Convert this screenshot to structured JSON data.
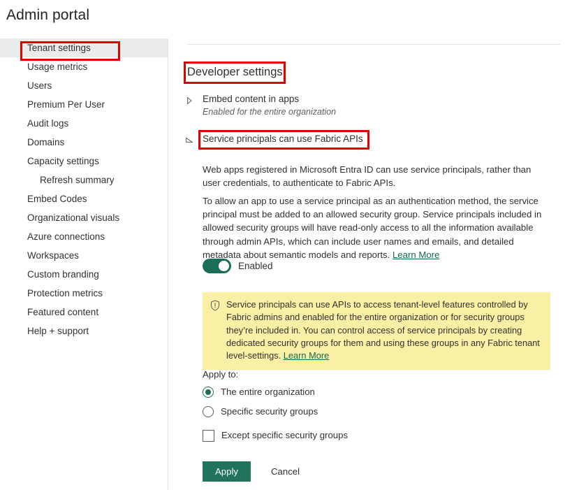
{
  "page": {
    "title": "Admin portal"
  },
  "sidebar": {
    "items": [
      {
        "label": "Tenant settings",
        "selected": true,
        "sub": false
      },
      {
        "label": "Usage metrics",
        "selected": false,
        "sub": false
      },
      {
        "label": "Users",
        "selected": false,
        "sub": false
      },
      {
        "label": "Premium Per User",
        "selected": false,
        "sub": false
      },
      {
        "label": "Audit logs",
        "selected": false,
        "sub": false
      },
      {
        "label": "Domains",
        "selected": false,
        "sub": false
      },
      {
        "label": "Capacity settings",
        "selected": false,
        "sub": false
      },
      {
        "label": "Refresh summary",
        "selected": false,
        "sub": true
      },
      {
        "label": "Embed Codes",
        "selected": false,
        "sub": false
      },
      {
        "label": "Organizational visuals",
        "selected": false,
        "sub": false
      },
      {
        "label": "Azure connections",
        "selected": false,
        "sub": false
      },
      {
        "label": "Workspaces",
        "selected": false,
        "sub": false
      },
      {
        "label": "Custom branding",
        "selected": false,
        "sub": false
      },
      {
        "label": "Protection metrics",
        "selected": false,
        "sub": false
      },
      {
        "label": "Featured content",
        "selected": false,
        "sub": false
      },
      {
        "label": "Help + support",
        "selected": false,
        "sub": false
      }
    ]
  },
  "main": {
    "section_heading": "Developer settings",
    "settings": [
      {
        "title": "Embed content in apps",
        "status": "Enabled for the entire organization",
        "expanded": false
      },
      {
        "title": "Service principals can use Fabric APIs",
        "expanded": true
      }
    ],
    "paragraph_1": "Web apps registered in Microsoft Entra ID can use service principals, rather than user credentials, to authenticate to Fabric APIs.",
    "paragraph_2": "To allow an app to use a service principal as an authentication method, the service principal must be added to an allowed security group. Service principals included in allowed security groups will have read-only access to all the information available through admin APIs, which can include user names and emails, and detailed metadata about semantic models and reports. ",
    "paragraph_2_link": "Learn More",
    "toggle_label": "Enabled",
    "banner_text": "Service principals can use APIs to access tenant-level features controlled by Fabric admins and enabled for the entire organization or for security groups they’re included in. You can control access of service principals by creating dedicated security groups for them and using these groups in any Fabric tenant level-settings. ",
    "banner_link": "Learn More",
    "apply_to_label": "Apply to:",
    "radio_entire_org": "The entire organization",
    "radio_specific_groups": "Specific security groups",
    "checkbox_except": "Except specific security groups",
    "apply_button": "Apply",
    "cancel_button": "Cancel"
  },
  "colors": {
    "accent_green": "#21735c",
    "toggle_on": "#1a6e58",
    "banner_yellow": "#faf0a5",
    "link": "#0f6b54",
    "annotation_red": "#e00000",
    "selected_nav_bg": "#ebebeb"
  }
}
